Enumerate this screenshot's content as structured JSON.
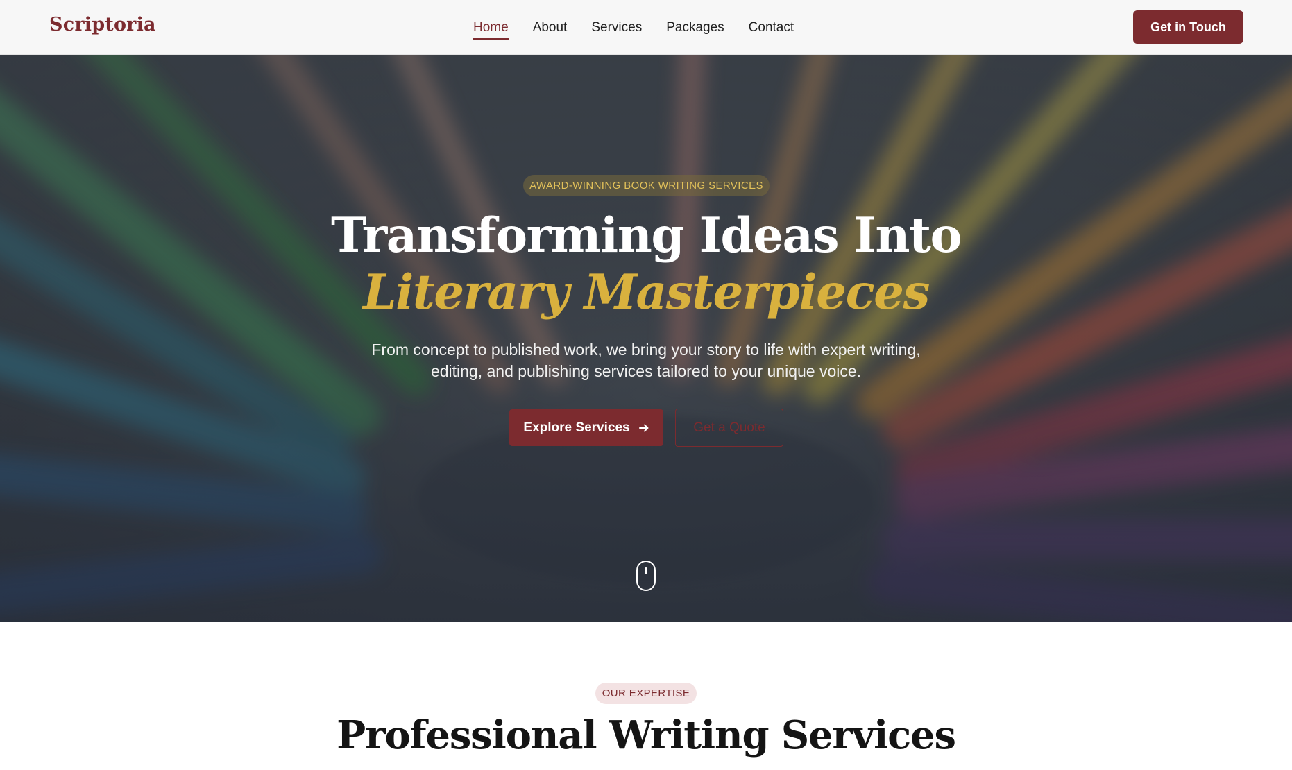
{
  "brand": {
    "name": "Scriptoria"
  },
  "nav": {
    "links": [
      {
        "label": "Home",
        "active": true
      },
      {
        "label": "About",
        "active": false
      },
      {
        "label": "Services",
        "active": false
      },
      {
        "label": "Packages",
        "active": false
      },
      {
        "label": "Contact",
        "active": false
      }
    ],
    "cta_label": "Get in Touch"
  },
  "hero": {
    "badge": "AWARD-WINNING BOOK WRITING SERVICES",
    "title_main": "Transforming Ideas Into ",
    "title_accent": "Literary Masterpieces",
    "subtitle": "From concept to published work, we bring your story to life with expert writing, editing, and publishing services tailored to your unique voice.",
    "primary_button": "Explore Services",
    "secondary_button": "Get a Quote",
    "scroll_icon": "mouse-icon"
  },
  "expertise": {
    "badge": "OUR EXPERTISE",
    "title": "Professional Writing Services"
  },
  "colors": {
    "brand": "#7c2b2f",
    "accent_gold": "#d9b13e",
    "nav_bg": "#f7f7f7"
  }
}
